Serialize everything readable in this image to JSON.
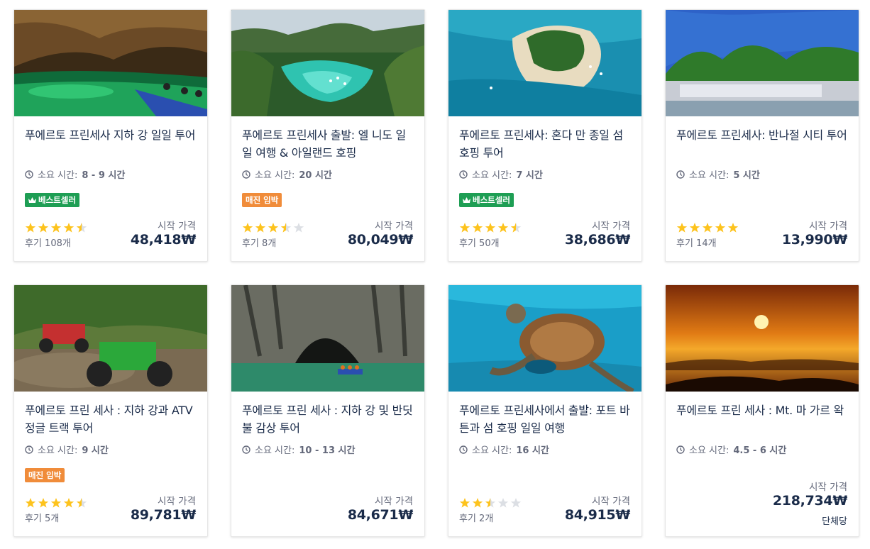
{
  "duration_label": "소요 시간:",
  "from_label": "시작 가격",
  "tours": [
    {
      "title": "푸에르토 프린세사 지하 강 일일 투어",
      "duration": "8 - 9 시간",
      "badge": "베스트셀러",
      "badge_type": "best",
      "rating": 4.5,
      "reviews": "후기 108개",
      "price": "48,418₩",
      "per": ""
    },
    {
      "title": "푸에르토 프린세사 출발: 엘 니도 일일 여행 & 아일랜드 호핑",
      "duration": "20 시간",
      "badge": "매진 임박",
      "badge_type": "sold",
      "rating": 3.5,
      "reviews": "후기 8개",
      "price": "80,049₩",
      "per": ""
    },
    {
      "title": "푸에르토 프린세사: 혼다 만 종일 섬 호핑 투어",
      "duration": "7 시간",
      "badge": "베스트셀러",
      "badge_type": "best",
      "rating": 4.5,
      "reviews": "후기 50개",
      "price": "38,686₩",
      "per": ""
    },
    {
      "title": "푸에르토 프린세사: 반나절 시티 투어",
      "duration": "5 시간",
      "badge": "",
      "badge_type": "",
      "rating": 5,
      "reviews": "후기 14개",
      "price": "13,990₩",
      "per": ""
    },
    {
      "title": "푸에르토 프린 세사 : 지하 강과 ATV 정글 트랙 투어",
      "duration": "9 시간",
      "badge": "매진 임박",
      "badge_type": "sold",
      "rating": 4.5,
      "reviews": "후기 5개",
      "price": "89,781₩",
      "per": ""
    },
    {
      "title": "푸에르토 프린 세사 : 지하 강 및 반딧불 감상 투어",
      "duration": "10 - 13 시간",
      "badge": "",
      "badge_type": "",
      "rating": 0,
      "reviews": "",
      "price": "84,671₩",
      "per": ""
    },
    {
      "title": "푸에르토 프린세사에서 출발: 포트 바튼과 섬 호핑 일일 여행",
      "duration": "16 시간",
      "badge": "",
      "badge_type": "",
      "rating": 2.5,
      "reviews": "후기 2개",
      "price": "84,915₩",
      "per": ""
    },
    {
      "title": "푸에르토 프린 세사 : Mt. 마 가르 왁",
      "duration": "4.5 - 6 시간",
      "badge": "",
      "badge_type": "",
      "rating": 0,
      "reviews": "",
      "price": "218,734₩",
      "per": "단체당"
    }
  ],
  "colors": {
    "star": "#fdc31d",
    "star_empty": "#dcdfe4",
    "best": "#1e9e54",
    "sold": "#f08c3a",
    "text": "#1a2b49",
    "muted": "#63687a"
  }
}
